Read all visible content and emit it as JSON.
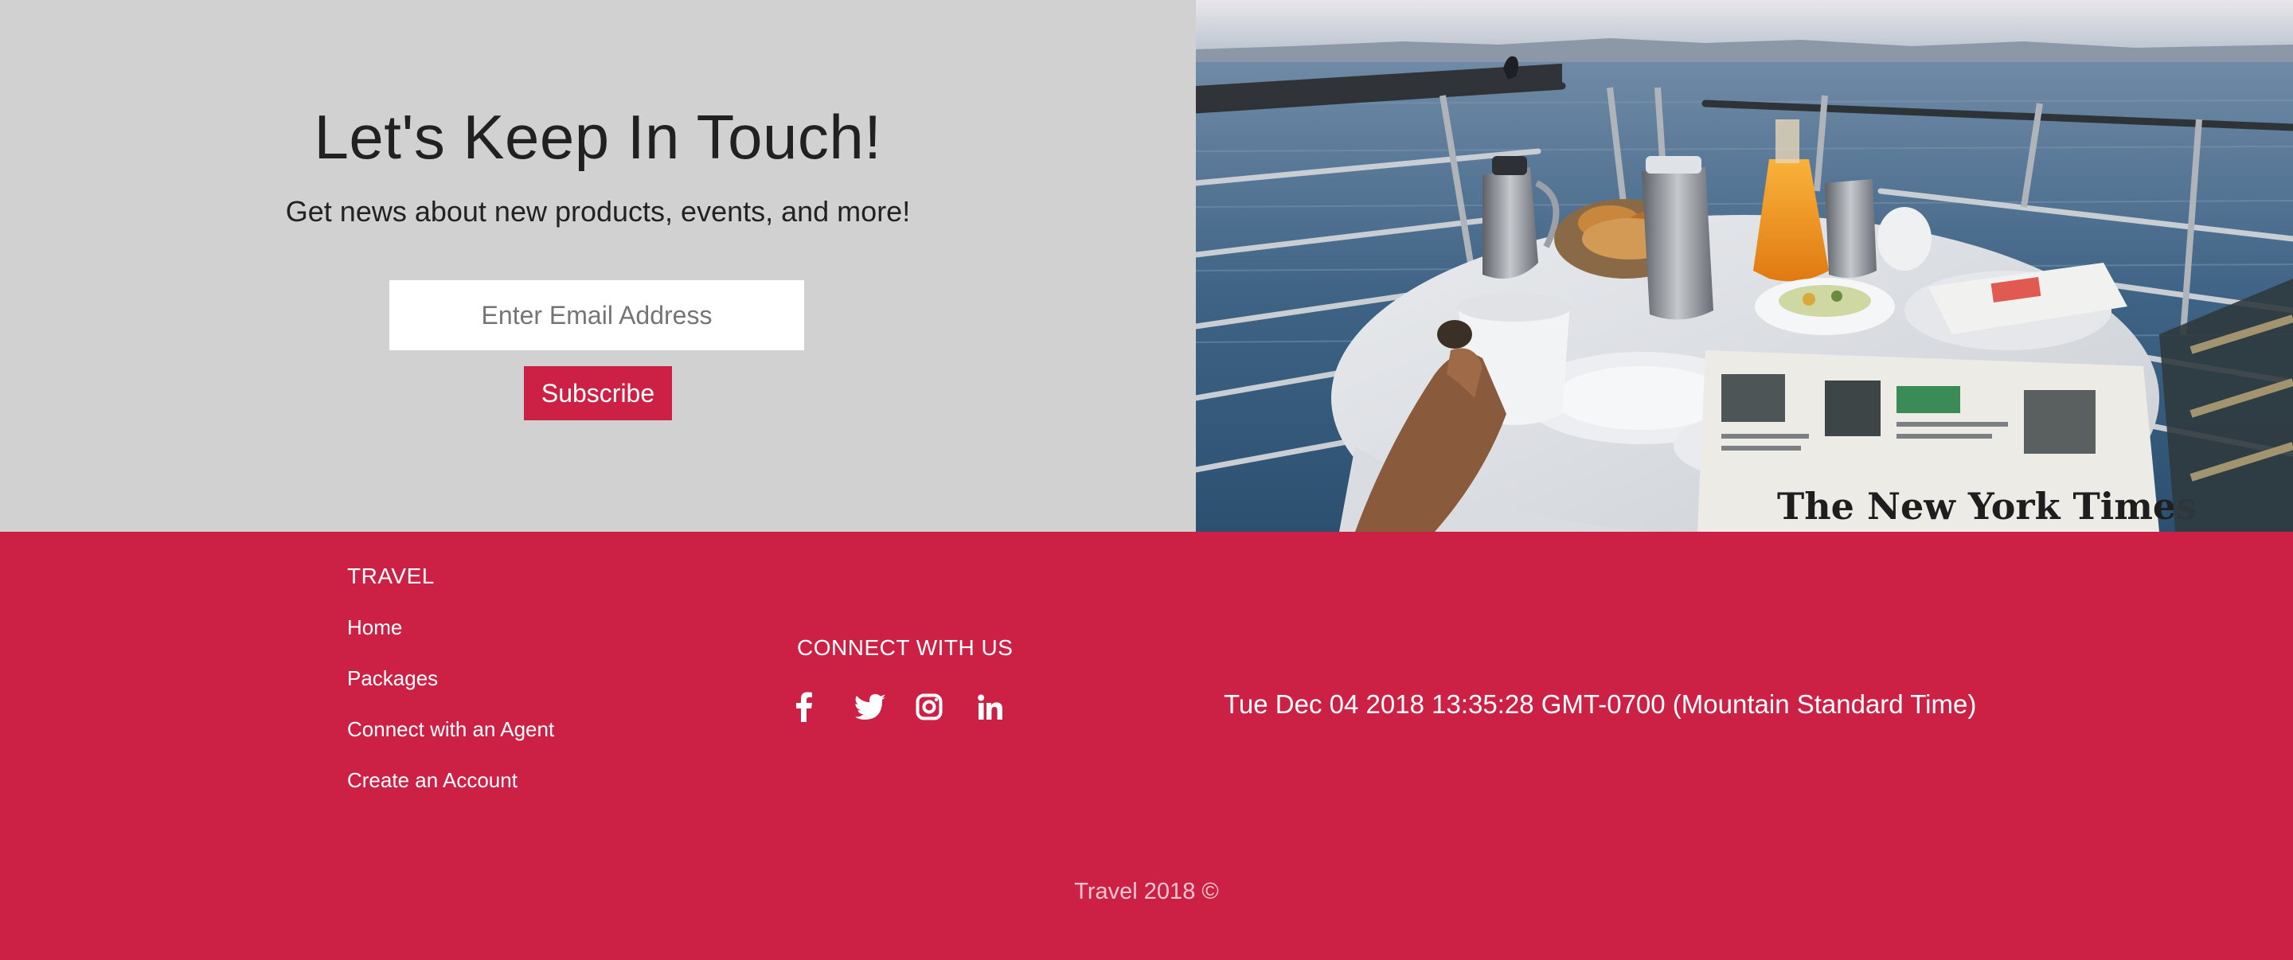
{
  "newsletter": {
    "title": "Let's Keep In Touch!",
    "subtitle": "Get news about new products, events, and more!",
    "email_placeholder": "Enter Email Address",
    "email_value": "",
    "subscribe_label": "Subscribe"
  },
  "footer": {
    "travel_title": "TRAVEL",
    "nav_links": [
      "Home",
      "Packages",
      "Connect with an Agent",
      "Create an Account"
    ],
    "connect_title": "CONNECT WITH US",
    "social_icons": [
      "facebook-icon",
      "twitter-icon",
      "instagram-icon",
      "linkedin-icon"
    ],
    "datetime": "Tue Dec 04 2018 13:35:28 GMT-0700 (Mountain Standard Time)",
    "copyright": "Travel 2018 ©"
  },
  "colors": {
    "accent": "#cc2145",
    "newsletter_bg": "#d1d1d1",
    "text_dark": "#212121",
    "white": "#ffffff"
  }
}
